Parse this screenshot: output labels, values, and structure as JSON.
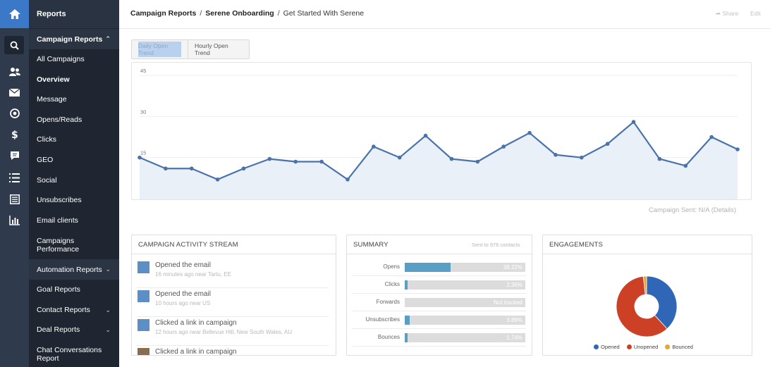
{
  "sidebar": {
    "header": "Reports",
    "items": [
      {
        "label": "Campaign Reports",
        "group": true,
        "chevron": "up"
      },
      {
        "label": "All Campaigns"
      },
      {
        "label": "Overview",
        "active": true
      },
      {
        "label": "Message"
      },
      {
        "label": "Opens/Reads"
      },
      {
        "label": "Clicks"
      },
      {
        "label": "GEO"
      },
      {
        "label": "Social"
      },
      {
        "label": "Unsubscribes"
      },
      {
        "label": "Email clients"
      },
      {
        "label": "Campaigns Performance"
      },
      {
        "label": "Automation Reports",
        "group": true,
        "chevron": "down"
      },
      {
        "label": "Goal Reports"
      },
      {
        "label": "Contact Reports",
        "chevron": "down"
      },
      {
        "label": "Deal Reports",
        "chevron": "down"
      },
      {
        "label": "Chat Conversations Report"
      }
    ]
  },
  "rail": {
    "icons": [
      "home-icon",
      "search-icon",
      "contacts-icon",
      "campaigns-mail-icon",
      "automations-icon",
      "deals-dollar-icon",
      "conversations-icon",
      "lists-icon",
      "forms-icon",
      "reports-chart-icon"
    ]
  },
  "breadcrumb": {
    "level1": "Campaign Reports",
    "sep": "/",
    "level2": "Serene Onboarding",
    "level3": "Get Started With Serene"
  },
  "toolbar": {
    "share": "Share",
    "edit": "Edit"
  },
  "tabs": {
    "first": "Daily Open Trend",
    "second": "Hourly Open Trend"
  },
  "chart_data": {
    "type": "area",
    "y_ticks": [
      "45",
      "30",
      "15"
    ],
    "ylim": [
      0,
      45
    ],
    "values": [
      15,
      11,
      11,
      7,
      11,
      14.5,
      13.5,
      13.5,
      7,
      19,
      15,
      23,
      14.5,
      13.5,
      19,
      24,
      16,
      15,
      20,
      28,
      14.5,
      12,
      22.5,
      18
    ]
  },
  "chart_note": "Campaign Sent: N/A (Details)",
  "activity": {
    "title": "CAMPAIGN ACTIVITY STREAM",
    "items": [
      {
        "title": "Opened the email",
        "sub": "16 minutes ago  near Tartu, EE"
      },
      {
        "title": "Opened the email",
        "sub": "10 hours ago  near US"
      },
      {
        "title": "Clicked a link in campaign",
        "sub": "12 hours ago  near Bellevue Hill, New South Wales, AU"
      },
      {
        "title": "Clicked a link in campaign",
        "sub": ""
      }
    ]
  },
  "summary": {
    "title": "SUMMARY",
    "sent": "Sent to 976 contacts",
    "rows": [
      {
        "label": "Opens",
        "value": "38.22%",
        "fill": 0.3822
      },
      {
        "label": "Clicks",
        "value": "2.36%",
        "fill": 0.0236
      },
      {
        "label": "Forwards",
        "value": "Not tracked",
        "fill": 0
      },
      {
        "label": "Unsubscribes",
        "value": "3.89%",
        "fill": 0.0389
      },
      {
        "label": "Bounces",
        "value": "1.74%",
        "fill": 0.0174
      }
    ]
  },
  "engagements": {
    "title": "ENGAGEMENTS",
    "slices": [
      {
        "name": "Opened",
        "value": 38.22,
        "color": "#2f66b5"
      },
      {
        "name": "Unopened",
        "value": 60.04,
        "color": "#cc4125"
      },
      {
        "name": "Bounced",
        "value": 1.74,
        "color": "#e8a33a"
      }
    ]
  }
}
